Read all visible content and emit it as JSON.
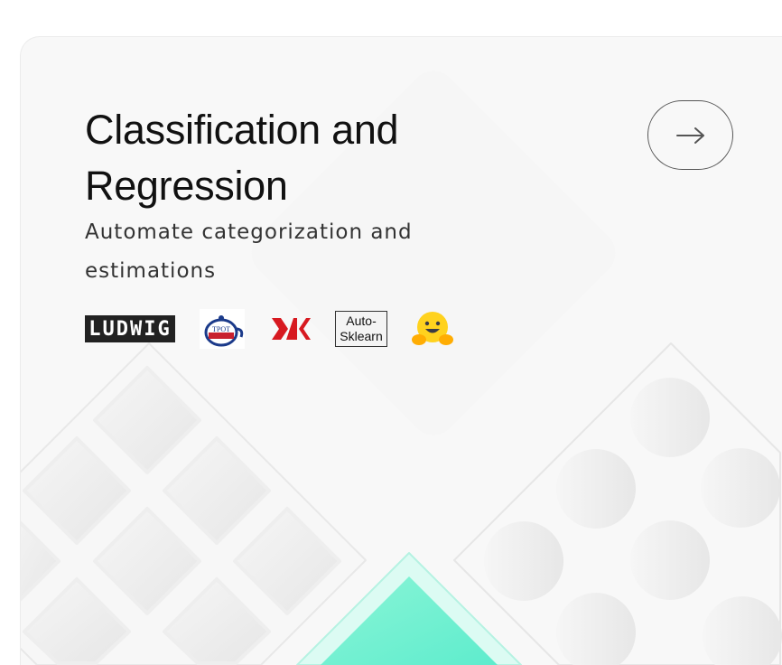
{
  "card": {
    "title_line1": "Classification and",
    "title_line2": "Regression",
    "subtitle": "Automate categorization and estimations",
    "arrow_button_icon": "arrow-right-icon",
    "logos": [
      {
        "name": "ludwig-logo",
        "text": "LUDWIG"
      },
      {
        "name": "tpot-logo",
        "text": "TPOT"
      },
      {
        "name": "autokeras-logo",
        "text": "AK"
      },
      {
        "name": "auto-sklearn-logo",
        "line1": "Auto-",
        "line2": "Sklearn"
      },
      {
        "name": "hugging-face-logo"
      }
    ],
    "accent_color": "#6ff0d3"
  }
}
